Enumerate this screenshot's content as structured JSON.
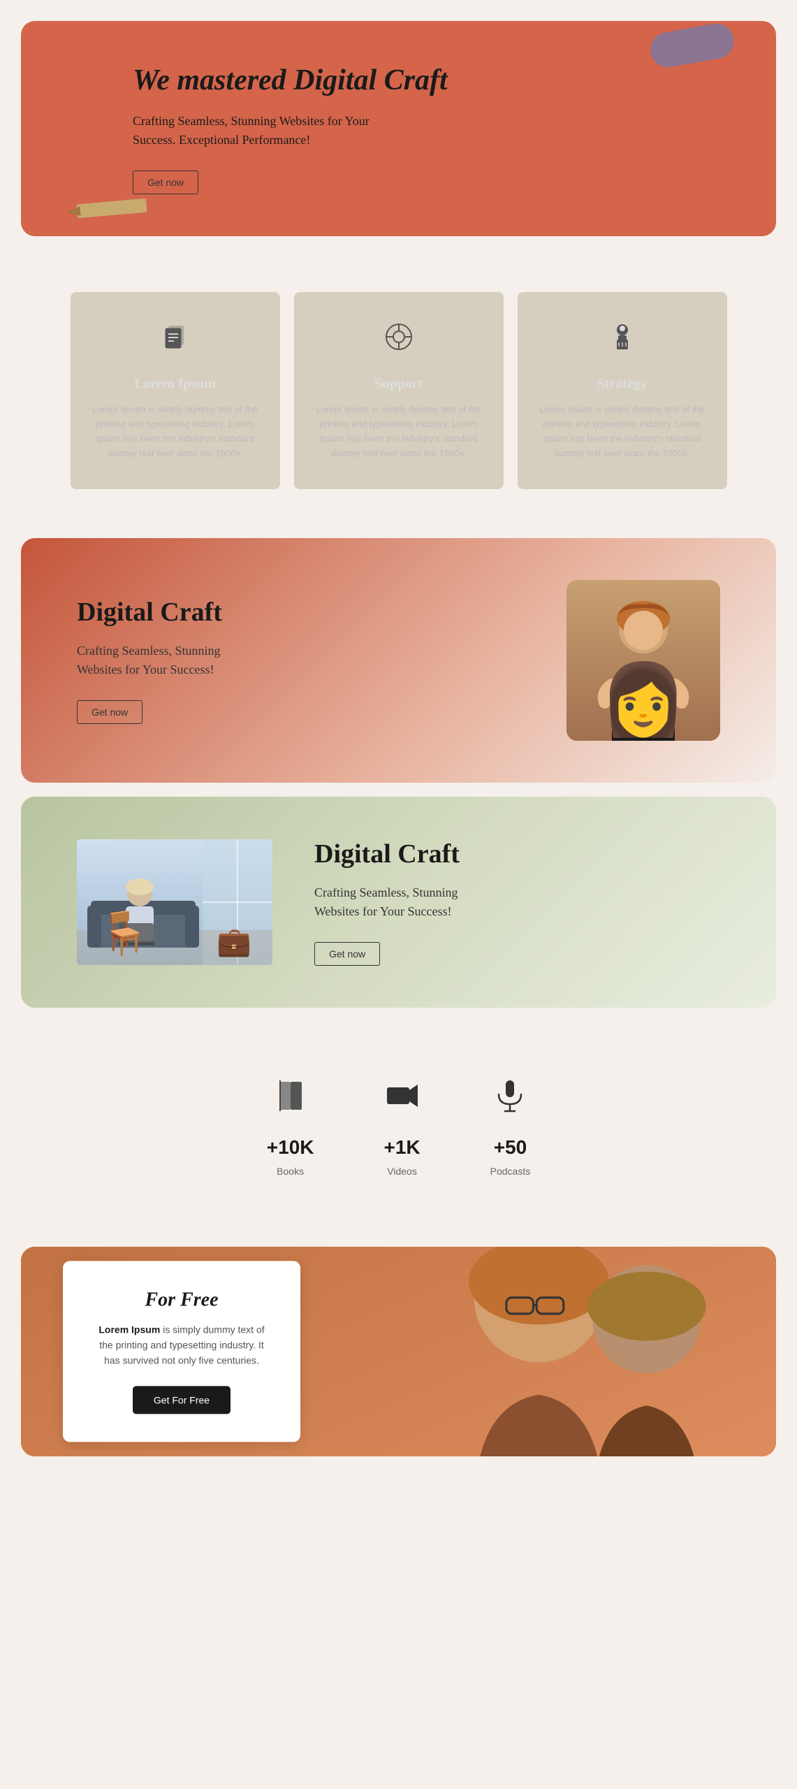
{
  "hero": {
    "title": "We mastered Digital Craft",
    "subtitle": "Crafting Seamless, Stunning Websites for Your Success. Exceptional Performance!",
    "cta_label": "Get now"
  },
  "cards": [
    {
      "id": "lorem-ipsum",
      "icon": "documents",
      "title": "Lorem Ipsum",
      "text": "Lorem Ipsum is simply dummy text of the printing and typesetting industry. Lorem Ipsum has been the industry's standard dummy text ever since the 1500s."
    },
    {
      "id": "support",
      "icon": "support",
      "title": "Support",
      "text": "Lorem Ipsum is simply dummy text of the printing and typesetting industry. Lorem Ipsum has been the industry's standard dummy text ever since the 1500s."
    },
    {
      "id": "strategy",
      "icon": "strategy",
      "title": "Strategy",
      "text": "Lorem Ipsum is simply dummy text of the printing and typesetting industry. Lorem Ipsum has been the industry's standard dummy text ever since the 1500s."
    }
  ],
  "digital_craft_1": {
    "title": "Digital Craft",
    "subtitle": "Crafting Seamless, Stunning\nWebsites for Your Success!",
    "cta_label": "Get now"
  },
  "digital_craft_2": {
    "title": "Digital Craft",
    "subtitle": "Crafting Seamless, Stunning\nWebsites for Your Success!",
    "cta_label": "Get now"
  },
  "stats": [
    {
      "icon": "book",
      "number": "+10K",
      "label": "Books"
    },
    {
      "icon": "video",
      "number": "+1K",
      "label": "Videos"
    },
    {
      "icon": "podcast",
      "number": "+50",
      "label": "Podcasts"
    }
  ],
  "for_free": {
    "title": "For Free",
    "text_prefix": "Lorem Ipsum",
    "text_body": " is simply dummy text of the printing and typesetting industry. It has survived not only five centuries.",
    "cta_label": "Get For Free"
  }
}
